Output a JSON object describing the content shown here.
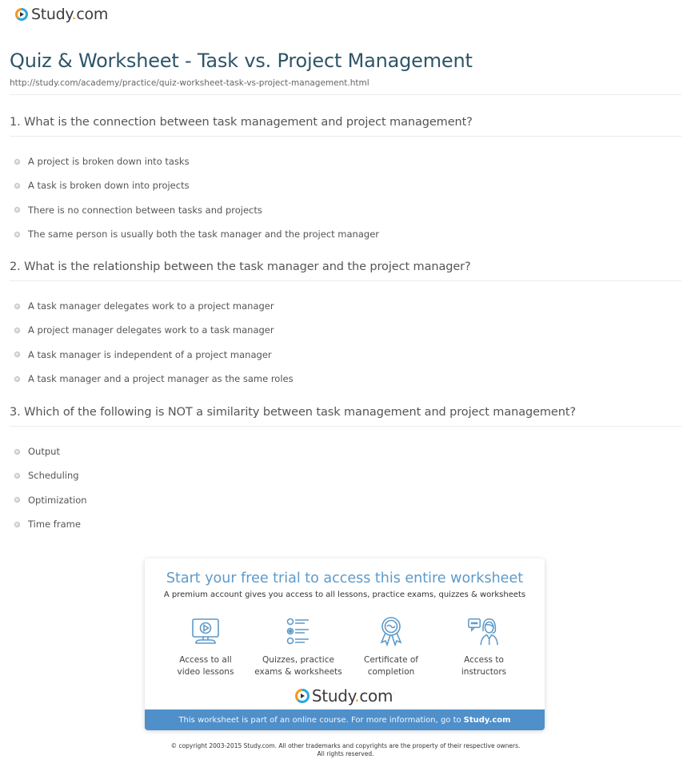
{
  "brand": {
    "name": "Study",
    "dot": ".",
    "tld": "com",
    "colors": {
      "blue": "#28a8e0",
      "orange": "#f5961e",
      "title": "#2e5567",
      "accent": "#5d9ac9",
      "bar": "#4f8fca"
    }
  },
  "header": {
    "logo_icon": "play-circle-icon",
    "title": "Quiz & Worksheet - Task vs. Project Management",
    "url": "http://study.com/academy/practice/quiz-worksheet-task-vs-project-management.html"
  },
  "questions": [
    {
      "text": "1. What is the connection between task management and project management?",
      "choices": [
        "A project is broken down into tasks",
        "A task is broken down into projects",
        "There is no connection between tasks and projects",
        "The same person is usually both the task manager and the project manager"
      ]
    },
    {
      "text": "2. What is the relationship between the task manager and the project manager?",
      "choices": [
        "A task manager delegates work to a project manager",
        "A project manager delegates work to a task manager",
        "A task manager is independent of a project manager",
        "A task manager and a project manager as the same roles"
      ]
    },
    {
      "text": "3. Which of the following is NOT a similarity between task management and project management?",
      "choices": [
        "Output",
        "Scheduling",
        "Optimization",
        "Time frame"
      ]
    }
  ],
  "promo": {
    "title": "Start your free trial to access this entire worksheet",
    "subtitle": "A premium account gives you access to all lessons, practice exams, quizzes & worksheets",
    "features": [
      {
        "icon": "video-monitor-icon",
        "line1": "Access to all",
        "line2": "video lessons"
      },
      {
        "icon": "quiz-list-icon",
        "line1": "Quizzes, practice",
        "line2": "exams & worksheets"
      },
      {
        "icon": "certificate-ribbon-icon",
        "line1": "Certificate of",
        "line2": "completion"
      },
      {
        "icon": "instructor-chat-icon",
        "line1": "Access to",
        "line2": "instructors"
      }
    ],
    "trademark": "·",
    "bar_text": "This worksheet is part of an online course. For more information, go to",
    "bar_link": "Study.com"
  },
  "footer": {
    "copyright_line1": "© copyright 2003-2015 Study.com. All other trademarks and copyrights are the property of their respective owners.",
    "copyright_line2": "All rights reserved."
  }
}
